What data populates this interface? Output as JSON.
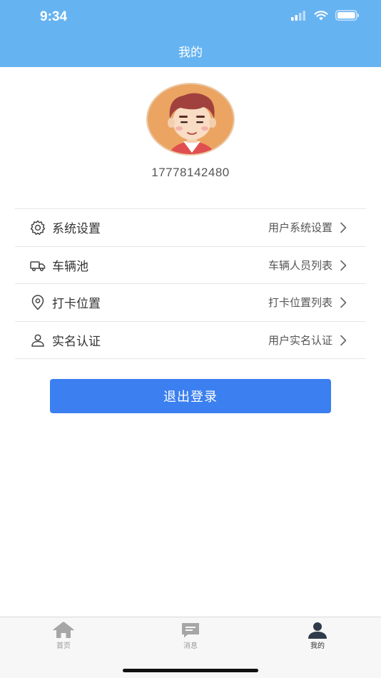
{
  "status_bar": {
    "time": "9:34"
  },
  "header": {
    "title": "我的"
  },
  "profile": {
    "phone": "17778142480"
  },
  "menu": {
    "items": [
      {
        "label": "系统设置",
        "value": "用户系统设置",
        "icon": "gear-icon"
      },
      {
        "label": "车辆池",
        "value": "车辆人员列表",
        "icon": "truck-icon"
      },
      {
        "label": "打卡位置",
        "value": "打卡位置列表",
        "icon": "location-pin-icon"
      },
      {
        "label": "实名认证",
        "value": "用户实名认证",
        "icon": "user-icon"
      }
    ]
  },
  "logout": {
    "label": "退出登录"
  },
  "tabbar": {
    "tabs": [
      {
        "label": "首页",
        "icon": "home-icon",
        "active": false
      },
      {
        "label": "消息",
        "icon": "message-icon",
        "active": false
      },
      {
        "label": "我的",
        "icon": "person-icon",
        "active": true
      }
    ]
  },
  "colors": {
    "header_bg": "#66b3f1",
    "button_bg": "#3b7ff0",
    "tab_active": "#333333",
    "tab_inactive": "#9a9a9a"
  }
}
